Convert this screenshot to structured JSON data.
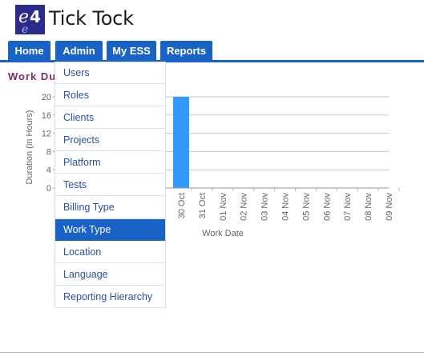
{
  "app": {
    "title": "Tick Tock",
    "logo_text": "e4"
  },
  "nav": {
    "tabs": [
      {
        "label": "Home"
      },
      {
        "label": "Admin"
      },
      {
        "label": "My ESS"
      },
      {
        "label": "Reports"
      }
    ]
  },
  "section": {
    "title_visible": "Work Du"
  },
  "admin_menu": {
    "items": [
      {
        "label": "Users"
      },
      {
        "label": "Roles"
      },
      {
        "label": "Clients"
      },
      {
        "label": "Projects"
      },
      {
        "label": "Platform"
      },
      {
        "label": "Tests"
      },
      {
        "label": "Billing Type"
      },
      {
        "label": "Work Type",
        "highlighted": true
      },
      {
        "label": "Location"
      },
      {
        "label": "Language"
      },
      {
        "label": "Reporting Hierarchy"
      }
    ]
  },
  "chart_data": {
    "type": "bar",
    "xlabel": "Work Date",
    "ylabel": "Duration (in Hours)",
    "y_ticks": [
      "20",
      "16",
      "12",
      "8",
      "4",
      "0"
    ],
    "ylim": [
      0,
      21
    ],
    "grid": true,
    "categories": [
      "30 Oct",
      "31 Oct",
      "01 Nov",
      "02 Nov",
      "03 Nov",
      "04 Nov",
      "05 Nov",
      "06 Nov",
      "07 Nov",
      "08 Nov",
      "09 Nov"
    ],
    "values": [
      20,
      0,
      0,
      0,
      0,
      0,
      0,
      0,
      0,
      0,
      0
    ],
    "bar_color": "#3399ff"
  }
}
